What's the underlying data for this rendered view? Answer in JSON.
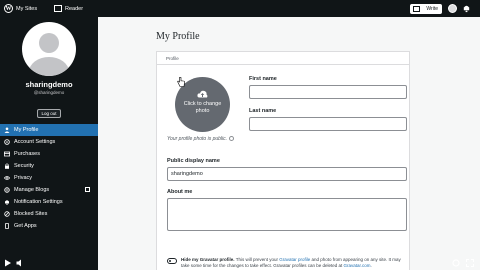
{
  "topbar": {
    "wp_logo": "W",
    "my_sites": "My Sites",
    "reader": "Reader",
    "write": "Write",
    "icons": [
      "wordpress-logo-icon",
      "reader-icon",
      "pencil-icon",
      "avatar-icon",
      "bell-icon"
    ]
  },
  "sidebar": {
    "username": "sharingdemo",
    "handle": "@sharingdemo",
    "logout": "Log out",
    "items": [
      {
        "label": "My Profile",
        "icon": "person-icon",
        "active": true
      },
      {
        "label": "Account Settings",
        "icon": "gear-icon"
      },
      {
        "label": "Purchases",
        "icon": "card-icon"
      },
      {
        "label": "Security",
        "icon": "lock-icon"
      },
      {
        "label": "Privacy",
        "icon": "eye-icon"
      },
      {
        "label": "Manage Blogs",
        "icon": "external-link-icon",
        "external": true
      },
      {
        "label": "Notification Settings",
        "icon": "bell-icon"
      },
      {
        "label": "Blocked Sites",
        "icon": "block-icon"
      },
      {
        "label": "Get Apps",
        "icon": "phone-icon"
      }
    ]
  },
  "main": {
    "title": "My Profile",
    "card_heading": "Profile",
    "picture": {
      "overlay_line1": "Click to change",
      "overlay_line2": "photo",
      "public_note": "Your profile photo is public."
    },
    "fields": {
      "first_name_label": "First name",
      "first_name_value": "",
      "last_name_label": "Last name",
      "last_name_value": "",
      "display_name_label": "Public display name",
      "display_name_value": "sharingdemo",
      "about_label": "About me",
      "about_value": ""
    },
    "hide_gravatar": {
      "title": "Hide my Gravatar profile.",
      "text_a": " This will prevent your ",
      "link_a": "Gravatar profile",
      "text_b": " and photo from appearing on any site. It may take some time for the changes to take effect. Gravatar profiles can be deleted at ",
      "link_b": "Gravatar.com",
      "text_c": "."
    }
  },
  "colors": {
    "accent": "#2271b1",
    "topbar": "#101517",
    "sidebar": "#101517",
    "background": "#f6f7f7"
  }
}
